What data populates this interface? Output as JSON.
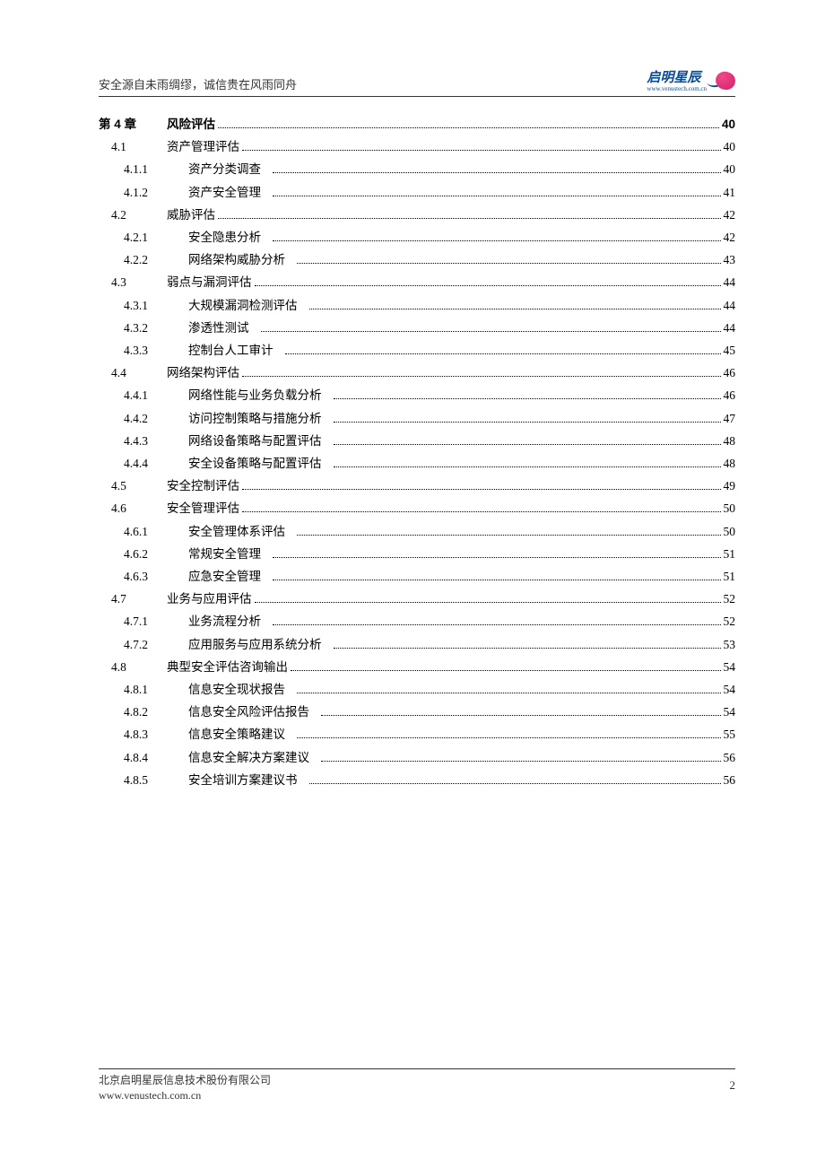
{
  "header": {
    "motto": "安全源自未雨绸缪，诚信贵在风雨同舟",
    "logo_text": "启明星辰",
    "logo_url": "www.venustech.com.cn"
  },
  "toc": [
    {
      "level": 1,
      "num": "第 4 章",
      "title": "风险评估",
      "page": "40"
    },
    {
      "level": 2,
      "num": "4.1",
      "title": "资产管理评估",
      "page": "40"
    },
    {
      "level": 3,
      "num": "4.1.1",
      "title": "资产分类调查",
      "page": "40"
    },
    {
      "level": 3,
      "num": "4.1.2",
      "title": "资产安全管理",
      "page": "41"
    },
    {
      "level": 2,
      "num": "4.2",
      "title": "威胁评估",
      "page": "42"
    },
    {
      "level": 3,
      "num": "4.2.1",
      "title": "安全隐患分析",
      "page": "42"
    },
    {
      "level": 3,
      "num": "4.2.2",
      "title": "网络架构威胁分析",
      "page": "43"
    },
    {
      "level": 2,
      "num": "4.3",
      "title": "弱点与漏洞评估",
      "page": "44"
    },
    {
      "level": 3,
      "num": "4.3.1",
      "title": "大规模漏洞检测评估",
      "page": "44"
    },
    {
      "level": 3,
      "num": "4.3.2",
      "title": "渗透性测试",
      "page": "44"
    },
    {
      "level": 3,
      "num": "4.3.3",
      "title": "控制台人工审计",
      "page": "45"
    },
    {
      "level": 2,
      "num": "4.4",
      "title": "网络架构评估",
      "page": "46"
    },
    {
      "level": 3,
      "num": "4.4.1",
      "title": "网络性能与业务负载分析",
      "page": "46"
    },
    {
      "level": 3,
      "num": "4.4.2",
      "title": "访问控制策略与措施分析",
      "page": "47"
    },
    {
      "level": 3,
      "num": "4.4.3",
      "title": "网络设备策略与配置评估",
      "page": "48"
    },
    {
      "level": 3,
      "num": "4.4.4",
      "title": "安全设备策略与配置评估",
      "page": "48"
    },
    {
      "level": 2,
      "num": "4.5",
      "title": "安全控制评估",
      "page": "49"
    },
    {
      "level": 2,
      "num": "4.6",
      "title": "安全管理评估",
      "page": "50"
    },
    {
      "level": 3,
      "num": "4.6.1",
      "title": "安全管理体系评估",
      "page": "50"
    },
    {
      "level": 3,
      "num": "4.6.2",
      "title": "常规安全管理",
      "page": "51"
    },
    {
      "level": 3,
      "num": "4.6.3",
      "title": "应急安全管理",
      "page": "51"
    },
    {
      "level": 2,
      "num": "4.7",
      "title": "业务与应用评估",
      "page": "52"
    },
    {
      "level": 3,
      "num": "4.7.1",
      "title": "业务流程分析",
      "page": "52"
    },
    {
      "level": 3,
      "num": "4.7.2",
      "title": "应用服务与应用系统分析",
      "page": "53"
    },
    {
      "level": 2,
      "num": "4.8",
      "title": "典型安全评估咨询输出",
      "page": "54"
    },
    {
      "level": 3,
      "num": "4.8.1",
      "title": "信息安全现状报告",
      "page": "54"
    },
    {
      "level": 3,
      "num": "4.8.2",
      "title": "信息安全风险评估报告",
      "page": "54"
    },
    {
      "level": 3,
      "num": "4.8.3",
      "title": "信息安全策略建议",
      "page": "55"
    },
    {
      "level": 3,
      "num": "4.8.4",
      "title": "信息安全解决方案建议",
      "page": "56"
    },
    {
      "level": 3,
      "num": "4.8.5",
      "title": "安全培训方案建议书",
      "page": "56"
    }
  ],
  "footer": {
    "company": "北京启明星辰信息技术股份有限公司",
    "website": "www.venustech.com.cn",
    "page_number": "2"
  }
}
